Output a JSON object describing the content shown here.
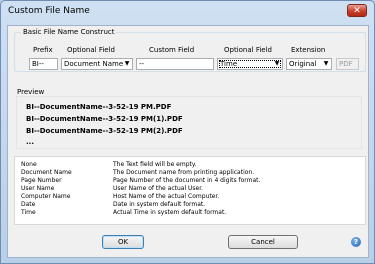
{
  "window": {
    "title": "Custom File Name",
    "close_glyph": "✕"
  },
  "construct": {
    "group_label": "Basic File Name Construct",
    "columns": {
      "prefix": "Prefix",
      "optional1": "Optional Field",
      "custom": "Custom Field",
      "optional2": "Optional Field",
      "extension": "Extension"
    },
    "prefix_value": "BI--",
    "optional1_value": "Document Name",
    "custom_value": "--",
    "optional2_value": "Time",
    "extension_value": "Original",
    "extension_suffix": "PDF"
  },
  "preview": {
    "label": "Preview",
    "lines": [
      "BI--DocumentName--3-52-19 PM.PDF",
      "BI--DocumentName--3-52-19 PM(1).PDF",
      "BI--DocumentName--3-52-19 PM(2).PDF",
      "..."
    ]
  },
  "legend": [
    {
      "key": "None",
      "desc": "The Text field will be empty."
    },
    {
      "key": "Document Name",
      "desc": "The Document name from printing application."
    },
    {
      "key": "Page Number",
      "desc": "Page Number of the document in 4 digits format."
    },
    {
      "key": "User Name",
      "desc": "User Name of the actual User."
    },
    {
      "key": "Computer Name",
      "desc": "Host Name of the actual Computer."
    },
    {
      "key": "Date",
      "desc": "Date in system default format."
    },
    {
      "key": "Time",
      "desc": "Actual Time in system default format."
    }
  ],
  "buttons": {
    "ok": "OK",
    "cancel": "Cancel",
    "help_glyph": "?"
  },
  "colors": {
    "accent": "#3c7fb1",
    "close": "#c8412a"
  }
}
